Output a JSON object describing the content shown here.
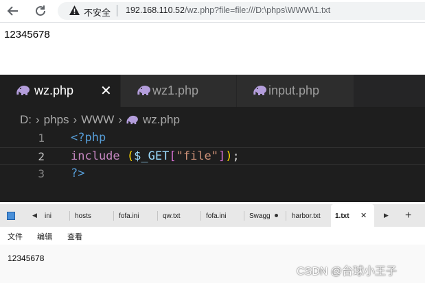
{
  "browser": {
    "security_label": "不安全",
    "url_host": "192.168.110.52",
    "url_path": "/wz.php?file=file:///D:\\phps\\WWW\\1.txt",
    "page_content": "12345678",
    "icons": [
      "back-arrow-icon",
      "reload-icon",
      "warning-icon"
    ]
  },
  "editor": {
    "tabs": [
      {
        "label": "wz.php",
        "active": true
      },
      {
        "label": "wz1.php",
        "active": false
      },
      {
        "label": "input.php",
        "active": false
      }
    ],
    "breadcrumb": [
      "D:",
      "phps",
      "WWW",
      "wz.php"
    ],
    "lines": [
      {
        "number": "1",
        "text": "<?php"
      },
      {
        "number": "2",
        "text": "include ($_GET[\"file\"]);"
      },
      {
        "number": "3",
        "text": "?>"
      }
    ],
    "tokens": {
      "open_tag": "<?php",
      "include_kw": "include",
      "lparen": "(",
      "var": "$_GET",
      "lbracket": "[",
      "str": "\"file\"",
      "rbracket": "]",
      "rparen": ")",
      "semicolon": ";",
      "close_tag": "?>"
    },
    "colors": {
      "background": "#1e1e1e",
      "keyword": "#c586c0",
      "string": "#ce9178",
      "variable": "#9cdcfe",
      "tag": "#569cd6"
    }
  },
  "notepad": {
    "tabs": [
      "ini",
      "hosts",
      "fofa.ini",
      "qw.txt",
      "fofa.ini",
      "Swagg",
      "harbor.txt",
      "1.txt"
    ],
    "active_tab": "1.txt",
    "close_glyph": "✕",
    "scroll_left_glyph": "◀",
    "scroll_right_glyph": "▶",
    "new_tab_glyph": "+",
    "menu": [
      "文件",
      "编辑",
      "查看"
    ],
    "content": "12345678"
  },
  "watermark": "CSDN @台球小王子"
}
